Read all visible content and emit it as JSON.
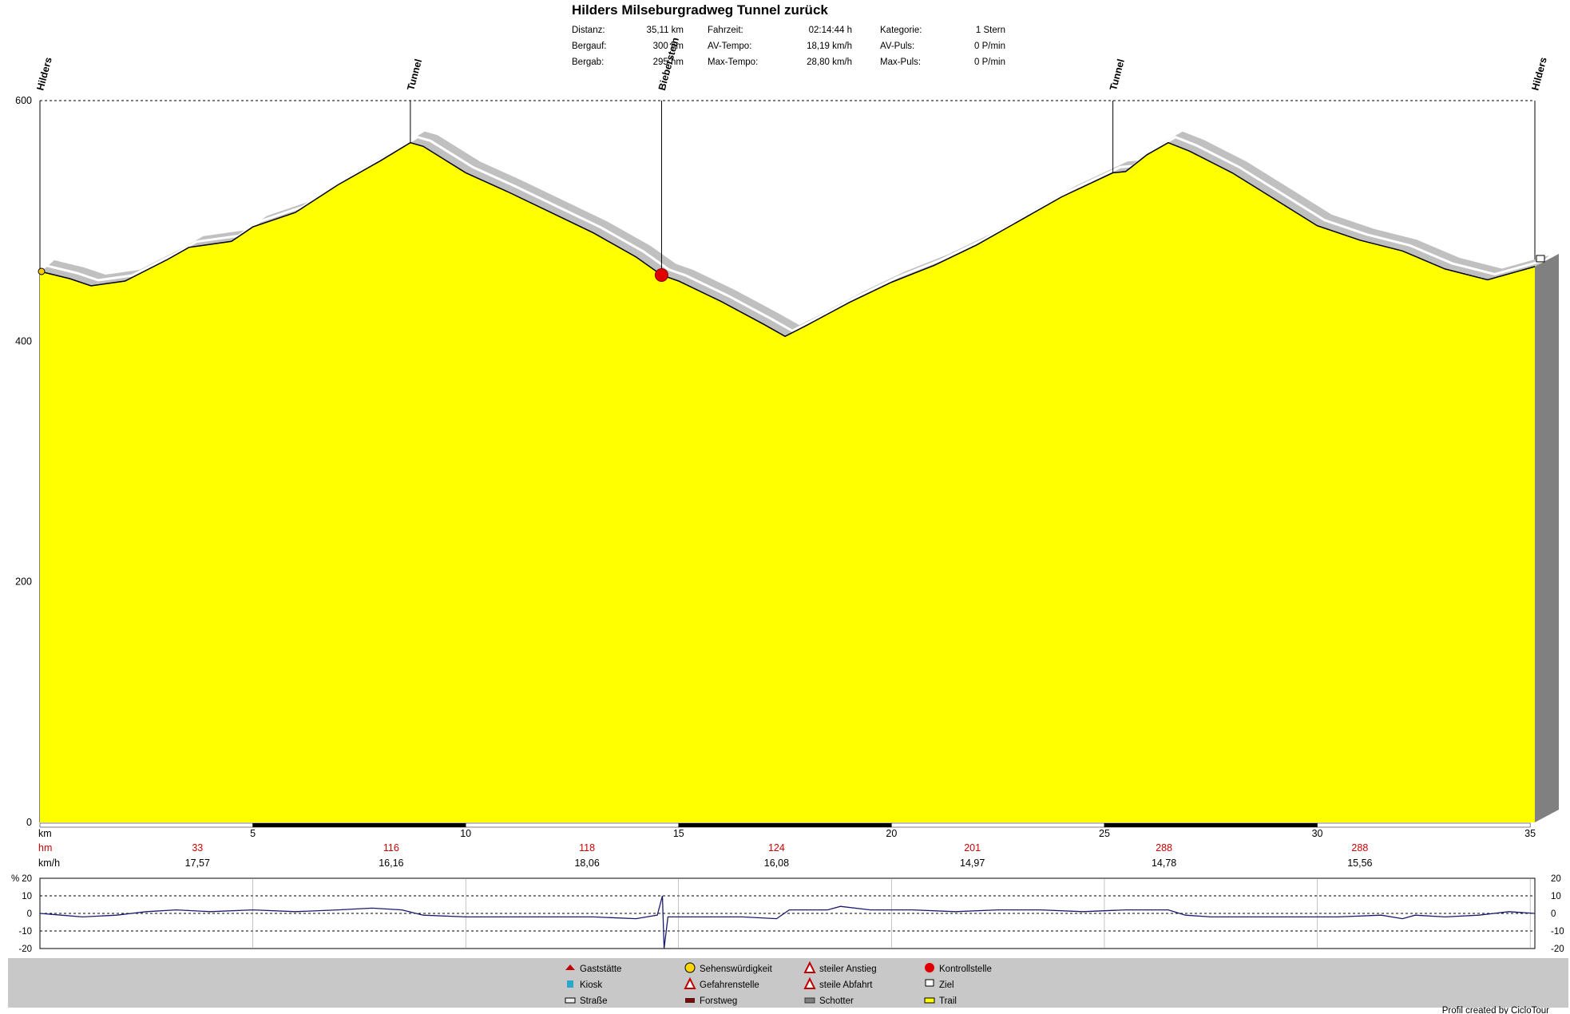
{
  "title": "Hilders Milseburgradweg Tunnel zurück",
  "stats": [
    {
      "label": "Distanz:",
      "value": "35,11 km"
    },
    {
      "label": "Bergauf:",
      "value": "300 hm"
    },
    {
      "label": "Bergab:",
      "value": "295 hm"
    },
    {
      "label": "Fahrzeit:",
      "value": "02:14:44 h"
    },
    {
      "label": "AV-Tempo:",
      "value": "18,19 km/h"
    },
    {
      "label": "Max-Tempo:",
      "value": "28,80 km/h"
    },
    {
      "label": "Kategorie:",
      "value": "1 Stern"
    },
    {
      "label": "AV-Puls:",
      "value": "0 P/min"
    },
    {
      "label": "Max-Puls:",
      "value": "0 P/min"
    }
  ],
  "colors": {
    "surface_fill": "#ffff00",
    "shadow_band": "#c0c0c0",
    "side_face": "#808080",
    "gradient_line": "#1a1a6e",
    "hm_text": "#cc0000",
    "legend_bg": "#c8c8c8"
  },
  "chart_data": [
    {
      "type": "area",
      "name": "elevation-profile",
      "x_unit": "km",
      "y_unit": "m",
      "xlim": [
        0,
        35.11
      ],
      "ylim": [
        0,
        600
      ],
      "y_ticks": [
        0,
        200,
        400,
        600
      ],
      "x_ticks": [
        5,
        10,
        15,
        20,
        25,
        30,
        35
      ],
      "x_axis_label": "km",
      "grid": true,
      "profile": [
        {
          "x": 0,
          "y": 458
        },
        {
          "x": 0.7,
          "y": 452
        },
        {
          "x": 1.2,
          "y": 446
        },
        {
          "x": 2.0,
          "y": 450
        },
        {
          "x": 3.0,
          "y": 468
        },
        {
          "x": 3.5,
          "y": 478
        },
        {
          "x": 4.5,
          "y": 483
        },
        {
          "x": 5.0,
          "y": 495
        },
        {
          "x": 6.0,
          "y": 507
        },
        {
          "x": 7.0,
          "y": 530
        },
        {
          "x": 8.0,
          "y": 550
        },
        {
          "x": 8.7,
          "y": 565
        },
        {
          "x": 9.0,
          "y": 562
        },
        {
          "x": 10.0,
          "y": 540
        },
        {
          "x": 11.0,
          "y": 524
        },
        {
          "x": 12.0,
          "y": 507
        },
        {
          "x": 13.0,
          "y": 490
        },
        {
          "x": 14.0,
          "y": 470
        },
        {
          "x": 14.6,
          "y": 455
        },
        {
          "x": 15.0,
          "y": 450
        },
        {
          "x": 16.0,
          "y": 433
        },
        {
          "x": 17.0,
          "y": 414
        },
        {
          "x": 17.5,
          "y": 404
        },
        {
          "x": 18.0,
          "y": 413
        },
        {
          "x": 19.0,
          "y": 432
        },
        {
          "x": 20.0,
          "y": 449
        },
        {
          "x": 21.0,
          "y": 463
        },
        {
          "x": 22.0,
          "y": 480
        },
        {
          "x": 23.0,
          "y": 500
        },
        {
          "x": 24.0,
          "y": 520
        },
        {
          "x": 25.2,
          "y": 540
        },
        {
          "x": 25.5,
          "y": 541
        },
        {
          "x": 26.0,
          "y": 555
        },
        {
          "x": 26.5,
          "y": 565
        },
        {
          "x": 27.0,
          "y": 558
        },
        {
          "x": 28.0,
          "y": 540
        },
        {
          "x": 29.0,
          "y": 518
        },
        {
          "x": 30.0,
          "y": 496
        },
        {
          "x": 31.0,
          "y": 484
        },
        {
          "x": 32.0,
          "y": 475
        },
        {
          "x": 33.0,
          "y": 460
        },
        {
          "x": 34.0,
          "y": 451
        },
        {
          "x": 35.11,
          "y": 462
        }
      ],
      "waypoints": [
        {
          "label": "Hilders",
          "x": 0
        },
        {
          "label": "Tunnel",
          "x": 8.7
        },
        {
          "label": "Bieberstein",
          "x": 14.6
        },
        {
          "label": "Tunnel",
          "x": 25.2
        },
        {
          "label": "Hilders",
          "x": 35.11
        }
      ]
    },
    {
      "type": "table",
      "name": "segment-summary",
      "rows": [
        {
          "label": "hm",
          "values": [
            "33",
            "116",
            "118",
            "124",
            "201",
            "288",
            "288"
          ]
        },
        {
          "label": "km/h",
          "values": [
            "17,57",
            "16,16",
            "18,06",
            "16,08",
            "14,97",
            "14,78",
            "15,56"
          ]
        }
      ],
      "positions_km": [
        3.7,
        8.25,
        12.85,
        17.3,
        21.9,
        26.4,
        31.0
      ]
    },
    {
      "type": "line",
      "name": "gradient",
      "y_unit": "%",
      "ylim": [
        -20,
        20
      ],
      "y_ticks": [
        20,
        10,
        0,
        -10,
        -20
      ],
      "points": [
        {
          "x": 0,
          "y": 0
        },
        {
          "x": 0.5,
          "y": -1
        },
        {
          "x": 1.0,
          "y": -2
        },
        {
          "x": 1.8,
          "y": -1
        },
        {
          "x": 2.5,
          "y": 1
        },
        {
          "x": 3.2,
          "y": 2
        },
        {
          "x": 4.0,
          "y": 1
        },
        {
          "x": 5.0,
          "y": 2
        },
        {
          "x": 6.0,
          "y": 1
        },
        {
          "x": 7.0,
          "y": 2
        },
        {
          "x": 7.8,
          "y": 3
        },
        {
          "x": 8.5,
          "y": 2
        },
        {
          "x": 9.0,
          "y": -1
        },
        {
          "x": 10.0,
          "y": -2
        },
        {
          "x": 11.0,
          "y": -2
        },
        {
          "x": 12.0,
          "y": -2
        },
        {
          "x": 13.0,
          "y": -2
        },
        {
          "x": 14.0,
          "y": -3
        },
        {
          "x": 14.5,
          "y": -1
        },
        {
          "x": 14.62,
          "y": 10
        },
        {
          "x": 14.66,
          "y": -20
        },
        {
          "x": 14.75,
          "y": -2
        },
        {
          "x": 15.5,
          "y": -2
        },
        {
          "x": 16.5,
          "y": -2
        },
        {
          "x": 17.3,
          "y": -3
        },
        {
          "x": 17.6,
          "y": 2
        },
        {
          "x": 18.5,
          "y": 2
        },
        {
          "x": 18.8,
          "y": 4
        },
        {
          "x": 19.5,
          "y": 2
        },
        {
          "x": 20.5,
          "y": 2
        },
        {
          "x": 21.5,
          "y": 1
        },
        {
          "x": 22.5,
          "y": 2
        },
        {
          "x": 23.5,
          "y": 2
        },
        {
          "x": 24.5,
          "y": 1
        },
        {
          "x": 25.5,
          "y": 2
        },
        {
          "x": 26.5,
          "y": 2
        },
        {
          "x": 26.9,
          "y": -1
        },
        {
          "x": 27.5,
          "y": -2
        },
        {
          "x": 28.5,
          "y": -2
        },
        {
          "x": 29.5,
          "y": -2
        },
        {
          "x": 30.5,
          "y": -2
        },
        {
          "x": 31.5,
          "y": -1
        },
        {
          "x": 32.0,
          "y": -3
        },
        {
          "x": 32.3,
          "y": -1
        },
        {
          "x": 33.0,
          "y": -2
        },
        {
          "x": 33.8,
          "y": -1
        },
        {
          "x": 34.5,
          "y": 1
        },
        {
          "x": 35.11,
          "y": 0
        }
      ]
    }
  ],
  "legend": [
    {
      "label": "Gaststätte",
      "icon": "house-icon"
    },
    {
      "label": "Kiosk",
      "icon": "kiosk-icon"
    },
    {
      "label": "Straße",
      "icon": "road-icon"
    },
    {
      "label": "Sehenswürdigkeit",
      "icon": "smiley-icon"
    },
    {
      "label": "Gefahrenstelle",
      "icon": "warning-icon"
    },
    {
      "label": "Forstweg",
      "icon": "forest-road-icon"
    },
    {
      "label": "steiler Anstieg",
      "icon": "steep-climb-icon"
    },
    {
      "label": "steile Abfahrt",
      "icon": "steep-descent-icon"
    },
    {
      "label": "Schotter",
      "icon": "gravel-icon"
    },
    {
      "label": "Kontrollstelle",
      "icon": "stop-icon"
    },
    {
      "label": "Ziel",
      "icon": "finish-flag-icon"
    },
    {
      "label": "Trail",
      "icon": "trail-icon"
    }
  ],
  "credit": "Profil created by CicloTour",
  "axis_labels": {
    "percent": "%",
    "km": "km"
  }
}
